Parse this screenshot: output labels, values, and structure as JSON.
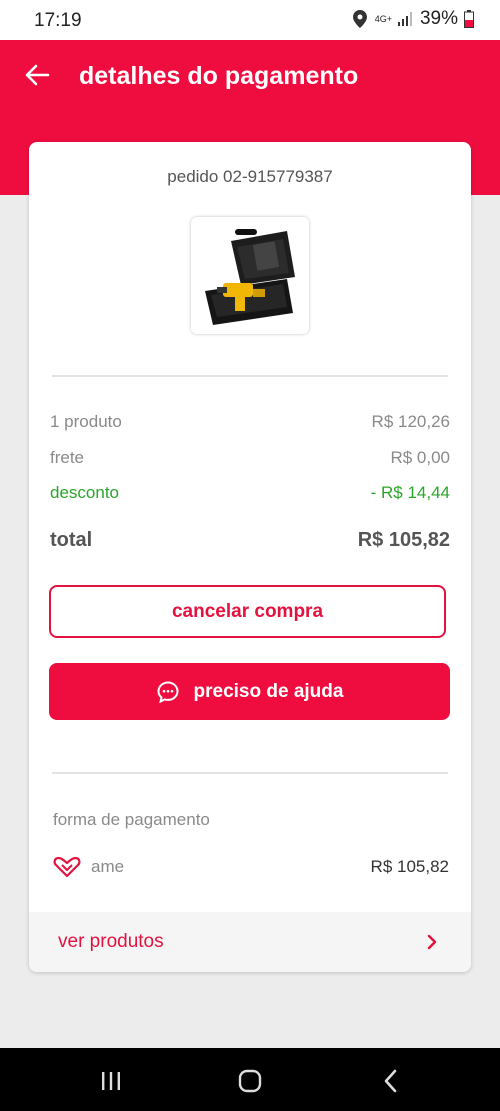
{
  "status_bar": {
    "time": "17:19",
    "network": "4G+",
    "battery": "39%"
  },
  "header": {
    "title": "detalhes do pagamento"
  },
  "order": {
    "id_label": "pedido 02-915779387",
    "summary": {
      "products_label": "1 produto",
      "products_value": "R$ 120,26",
      "shipping_label": "frete",
      "shipping_value": "R$ 0,00",
      "discount_label": "desconto",
      "discount_value": "- R$ 14,44",
      "total_label": "total",
      "total_value": "R$ 105,82"
    },
    "actions": {
      "cancel_label": "cancelar compra",
      "help_label": "preciso de ajuda"
    },
    "payment": {
      "section_label": "forma de pagamento",
      "method": "ame",
      "amount": "R$ 105,82"
    },
    "see_products_label": "ver produtos"
  },
  "colors": {
    "brand_red": "#ef0d3f",
    "discount_green": "#2aa62a"
  }
}
